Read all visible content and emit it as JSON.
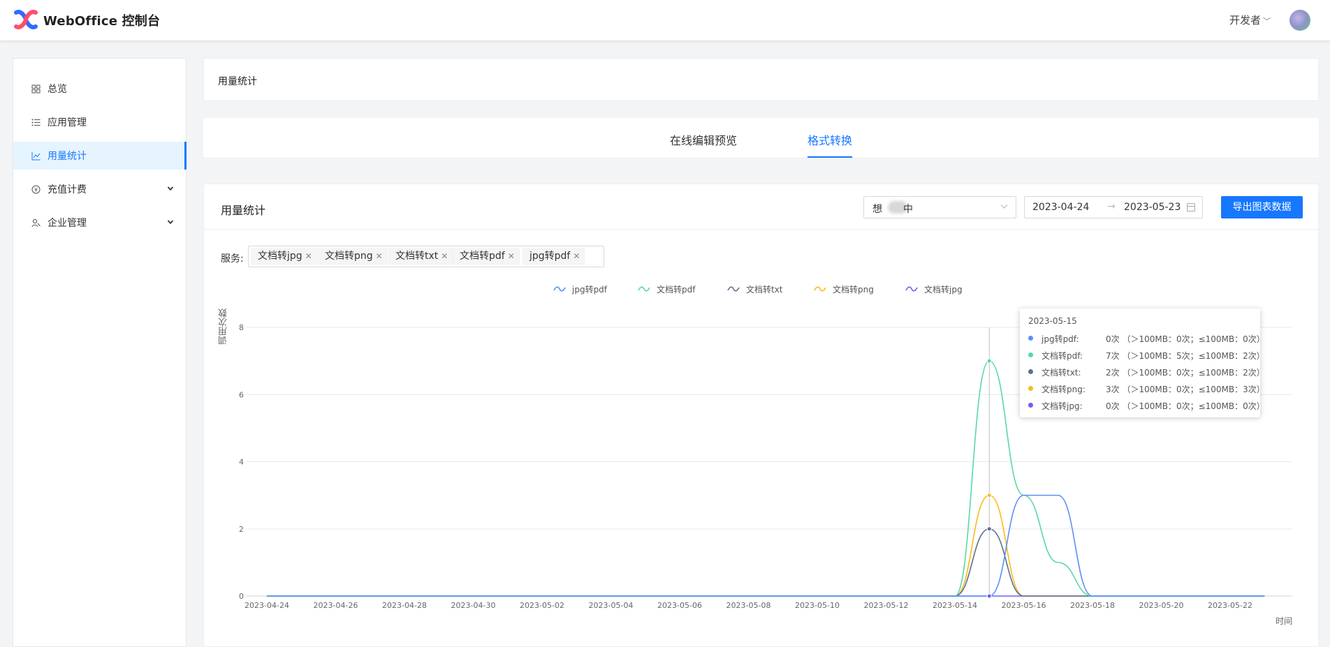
{
  "app": {
    "title": "WebOffice 控制台",
    "user_role": "开发者"
  },
  "sidebar": {
    "items": [
      {
        "label": "总览",
        "icon": "grid-icon",
        "active": false
      },
      {
        "label": "应用管理",
        "icon": "list-icon",
        "active": false
      },
      {
        "label": "用量统计",
        "icon": "line-chart-icon",
        "active": true
      },
      {
        "label": "充值计费",
        "icon": "coin-icon",
        "active": false,
        "expandable": true
      },
      {
        "label": "企业管理",
        "icon": "team-icon",
        "active": false,
        "expandable": true
      }
    ]
  },
  "header": {
    "title": "用量统计"
  },
  "tabs": [
    {
      "label": "在线编辑预览",
      "active": false
    },
    {
      "label": "格式转换",
      "active": true
    }
  ],
  "card": {
    "title": "用量统计",
    "app_select": {
      "prefix": "想",
      "suffix": "中"
    },
    "date_range": {
      "start": "2023-04-24",
      "end": "2023-05-23"
    },
    "export_label": "导出图表数据",
    "service_label": "服务:",
    "service_tags": [
      "文档转jpg",
      "文档转png",
      "文档转txt",
      "文档转pdf",
      "jpg转pdf"
    ]
  },
  "colors": {
    "accent": "#1677ff",
    "jpg_to_pdf": "#5b8ff9",
    "doc_to_pdf": "#5ad8a6",
    "doc_to_txt": "#5d7092",
    "doc_to_png": "#f6bd16",
    "doc_to_jpg": "#6f5ef9"
  },
  "chart_data": {
    "type": "line",
    "ylabel": "调用次数",
    "xlabel": "时间",
    "ylim": [
      0,
      8
    ],
    "yticks": [
      0,
      2,
      4,
      6,
      8
    ],
    "xticks": [
      "2023-04-24",
      "2023-04-26",
      "2023-04-28",
      "2023-04-30",
      "2023-05-02",
      "2023-05-04",
      "2023-05-06",
      "2023-05-08",
      "2023-05-10",
      "2023-05-12",
      "2023-05-14",
      "2023-05-16",
      "2023-05-18",
      "2023-05-20",
      "2023-05-22"
    ],
    "x": [
      "2023-04-24",
      "2023-04-25",
      "2023-04-26",
      "2023-04-27",
      "2023-04-28",
      "2023-04-29",
      "2023-04-30",
      "2023-05-01",
      "2023-05-02",
      "2023-05-03",
      "2023-05-04",
      "2023-05-05",
      "2023-05-06",
      "2023-05-07",
      "2023-05-08",
      "2023-05-09",
      "2023-05-10",
      "2023-05-11",
      "2023-05-12",
      "2023-05-13",
      "2023-05-14",
      "2023-05-15",
      "2023-05-16",
      "2023-05-17",
      "2023-05-18",
      "2023-05-19",
      "2023-05-20",
      "2023-05-21",
      "2023-05-22",
      "2023-05-23"
    ],
    "legend_position": "top-center",
    "grid": true,
    "series": [
      {
        "name": "jpg转pdf",
        "color": "#5b8ff9",
        "values": [
          0,
          0,
          0,
          0,
          0,
          0,
          0,
          0,
          0,
          0,
          0,
          0,
          0,
          0,
          0,
          0,
          0,
          0,
          0,
          0,
          0,
          0,
          3,
          3,
          0,
          0,
          0,
          0,
          0,
          0
        ]
      },
      {
        "name": "文档转pdf",
        "color": "#5ad8a6",
        "values": [
          0,
          0,
          0,
          0,
          0,
          0,
          0,
          0,
          0,
          0,
          0,
          0,
          0,
          0,
          0,
          0,
          0,
          0,
          0,
          0,
          0,
          7,
          3,
          1,
          0,
          0,
          0,
          0,
          0,
          0
        ]
      },
      {
        "name": "文档转txt",
        "color": "#5d7092",
        "values": [
          0,
          0,
          0,
          0,
          0,
          0,
          0,
          0,
          0,
          0,
          0,
          0,
          0,
          0,
          0,
          0,
          0,
          0,
          0,
          0,
          0,
          2,
          0,
          0,
          0,
          0,
          0,
          0,
          0,
          0
        ]
      },
      {
        "name": "文档转png",
        "color": "#f6bd16",
        "values": [
          0,
          0,
          0,
          0,
          0,
          0,
          0,
          0,
          0,
          0,
          0,
          0,
          0,
          0,
          0,
          0,
          0,
          0,
          0,
          0,
          0,
          3,
          0,
          0,
          0,
          0,
          0,
          0,
          0,
          0
        ]
      },
      {
        "name": "文档转jpg",
        "color": "#6f5ef9",
        "values": [
          0,
          0,
          0,
          0,
          0,
          0,
          0,
          0,
          0,
          0,
          0,
          0,
          0,
          0,
          0,
          0,
          0,
          0,
          0,
          0,
          0,
          0,
          0,
          0,
          0,
          0,
          0,
          0,
          0,
          0
        ]
      }
    ],
    "tooltip": {
      "date": "2023-05-15",
      "rows": [
        {
          "name": "jpg转pdf:",
          "value": "0次 （＞100MB：0次；≤100MB：0次）"
        },
        {
          "name": "文档转pdf:",
          "value": "7次 （＞100MB：5次；≤100MB：2次）"
        },
        {
          "name": "文档转txt:",
          "value": "2次 （＞100MB：0次；≤100MB：2次）"
        },
        {
          "name": "文档转png:",
          "value": "3次 （＞100MB：0次；≤100MB：3次）"
        },
        {
          "name": "文档转jpg:",
          "value": "0次 （＞100MB：0次；≤100MB：0次）"
        }
      ]
    }
  }
}
